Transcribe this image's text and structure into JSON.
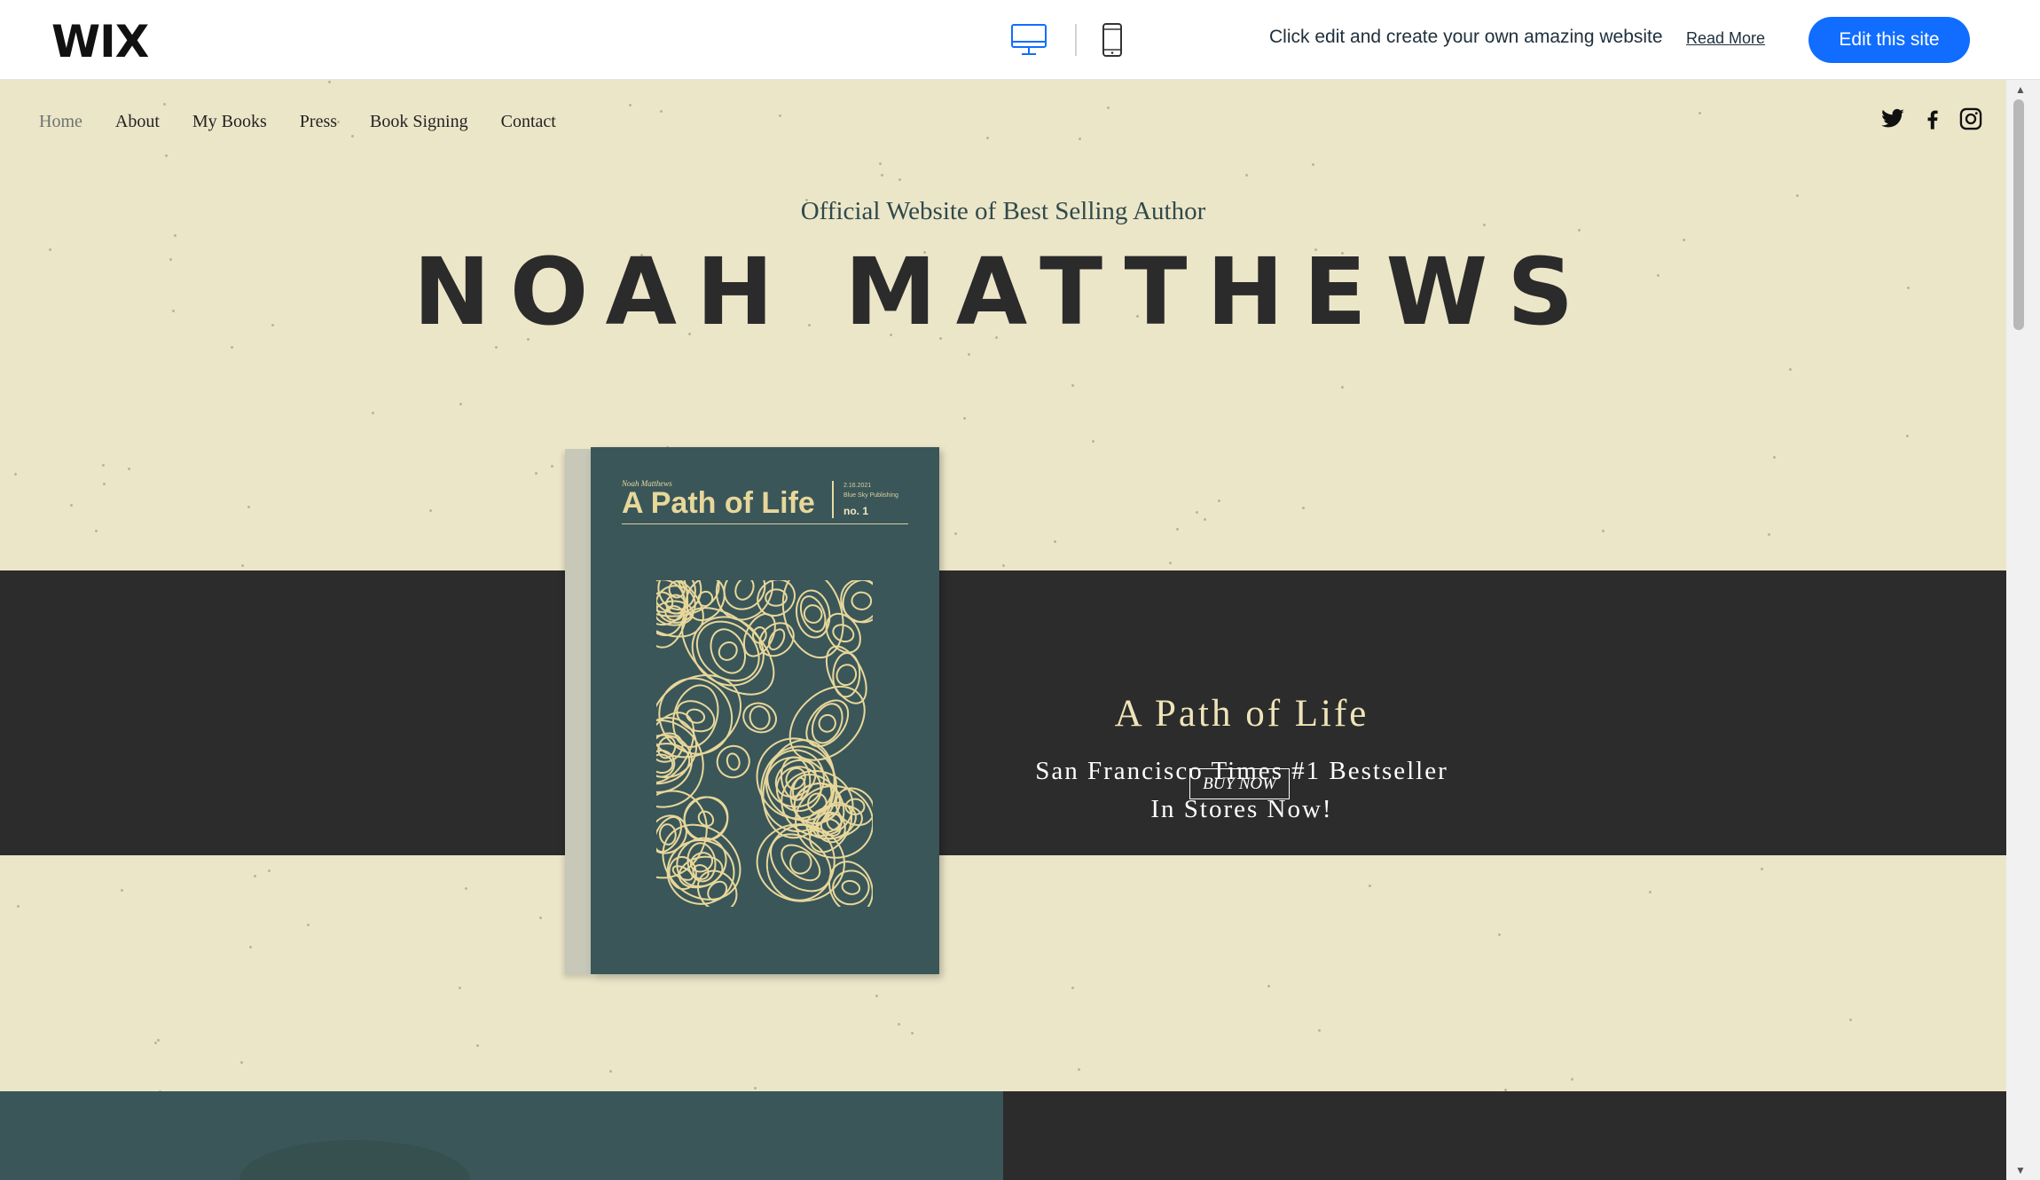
{
  "wix_bar": {
    "logo": "WIX",
    "promo_text": "Click edit and create your own amazing website",
    "read_more_label": "Read More",
    "edit_button_label": "Edit this site",
    "desktop_icon": "desktop-icon",
    "mobile_icon": "mobile-icon"
  },
  "nav": {
    "items": [
      {
        "label": "Home"
      },
      {
        "label": "About"
      },
      {
        "label": "My Books"
      },
      {
        "label": "Press"
      },
      {
        "label": "Book Signing"
      },
      {
        "label": "Contact"
      }
    ],
    "social_icons": [
      "twitter-icon",
      "facebook-icon",
      "instagram-icon"
    ]
  },
  "header": {
    "subtitle": "Official Website of Best Selling Author",
    "author_name": "NOAH MATTHEWS"
  },
  "book_cover": {
    "author": "Noah Matthews",
    "title": "A Path of Life",
    "date": "2.16.2021",
    "publisher": "Blue Sky Publishing",
    "number": "no. 1"
  },
  "hero": {
    "title": "A Path of Life",
    "line1": "San Francisco Times #1 Bestseller",
    "line2": "In Stores Now!",
    "buy_label": "BUY NOW"
  },
  "colors": {
    "page_bg": "#ece6c9",
    "dark_band": "#2c2c2c",
    "teal": "#3a5658",
    "accent_gold": "#e8d79b",
    "wix_blue": "#116dff"
  }
}
